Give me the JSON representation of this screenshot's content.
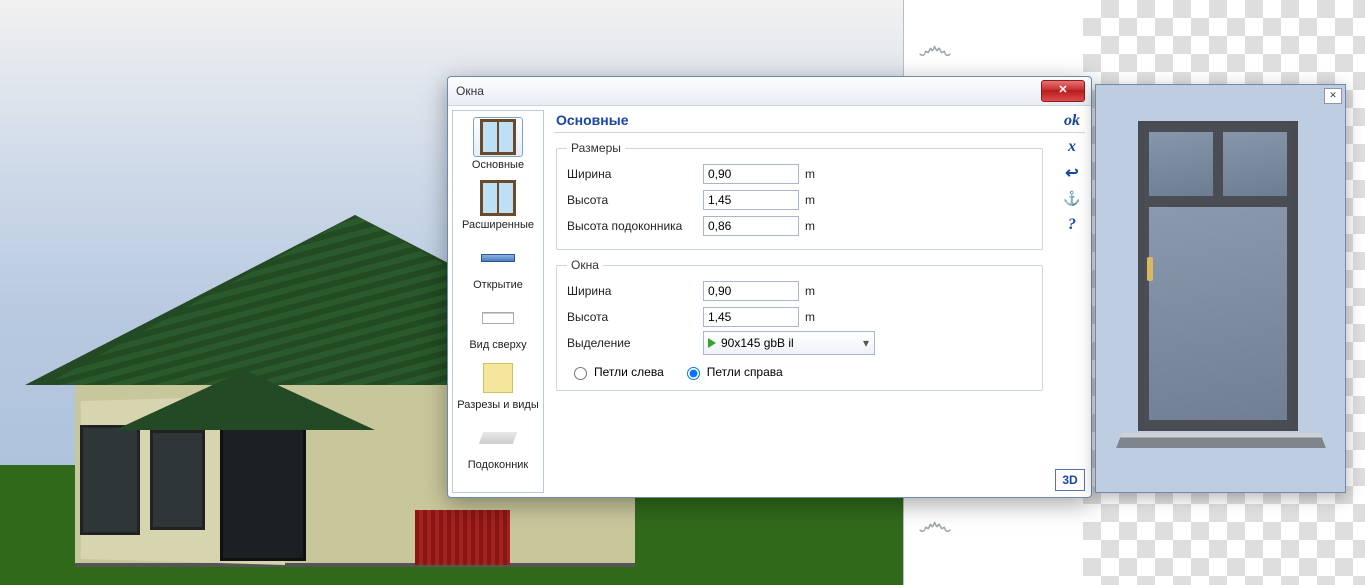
{
  "dialog": {
    "title": "Окна",
    "close_glyph": "✕",
    "header": "Основные",
    "nav": [
      {
        "label": "Основные"
      },
      {
        "label": "Расширенные"
      },
      {
        "label": "Открытие"
      },
      {
        "label": "Вид сверху"
      },
      {
        "label": "Разрезы и виды"
      },
      {
        "label": "Подоконник"
      }
    ],
    "right_buttons": {
      "ok": "ok",
      "cancel": "x",
      "back": "↩",
      "anchor": "⚓",
      "help": "?"
    },
    "badge_3d": "3D",
    "groups": {
      "dims": {
        "legend": "Размеры",
        "width_label": "Ширина",
        "width_value": "0,90",
        "height_label": "Высота",
        "height_value": "1,45",
        "sill_label": "Высота подоконника",
        "sill_value": "0,86",
        "unit": "m"
      },
      "windows": {
        "legend": "Окна",
        "width_label": "Ширина",
        "width_value": "0,90",
        "height_label": "Высота",
        "height_value": "1,45",
        "unit": "m",
        "selection_label": "Выделение",
        "selection_value": "90x145 gbB il",
        "hinge_left": "Петли слева",
        "hinge_right": "Петли справа",
        "hinge": "right"
      }
    }
  },
  "preview": {
    "close_glyph": "✕"
  }
}
